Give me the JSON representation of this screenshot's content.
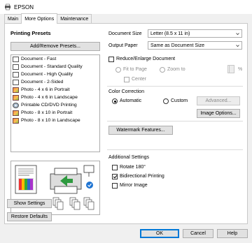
{
  "window": {
    "title": "EPSON"
  },
  "tabs": [
    {
      "label": "Main"
    },
    {
      "label": "More Options"
    },
    {
      "label": "Maintenance"
    }
  ],
  "presets": {
    "heading": "Printing Presets",
    "add_remove_button": "Add/Remove Presets...",
    "items": [
      {
        "label": "Document - Fast",
        "icon": "document"
      },
      {
        "label": "Document - Standard Quality",
        "icon": "document"
      },
      {
        "label": "Document - High Quality",
        "icon": "document"
      },
      {
        "label": "Document - 2-Sided",
        "icon": "document"
      },
      {
        "label": "Photo - 4 x 6 in Portrait",
        "icon": "photo"
      },
      {
        "label": "Photo - 4 x 6 in Landscape",
        "icon": "photo"
      },
      {
        "label": "Printable CD/DVD Printing",
        "icon": "cd"
      },
      {
        "label": "Photo - 8 x 10 in Portrait",
        "icon": "photo"
      },
      {
        "label": "Photo - 8 x 10 in Landscape",
        "icon": "photo"
      }
    ]
  },
  "left_buttons": {
    "show_settings": "Show Settings",
    "restore_defaults": "Restore Defaults"
  },
  "document_size": {
    "label": "Document Size",
    "value": "Letter (8.5 x 11 in)"
  },
  "output_paper": {
    "label": "Output Paper",
    "value": "Same as Document Size"
  },
  "reduce_enlarge": {
    "label": "Reduce/Enlarge Document",
    "checked": false,
    "fit_to_page": "Fit to Page",
    "zoom_to": "Zoom to",
    "center": "Center",
    "percent": "%"
  },
  "color_correction": {
    "heading": "Color Correction",
    "automatic": "Automatic",
    "custom": "Custom",
    "selected": "Automatic",
    "advanced_button": "Advanced...",
    "image_options_button": "Image Options..."
  },
  "watermark_button": "Watermark Features...",
  "additional_settings": {
    "heading": "Additional Settings",
    "rotate": {
      "label": "Rotate 180°",
      "checked": false
    },
    "bidirectional": {
      "label": "Bidirectional Printing",
      "checked": true
    },
    "mirror": {
      "label": "Mirror Image",
      "checked": false
    }
  },
  "footer": {
    "ok": "OK",
    "cancel": "Cancel",
    "help": "Help"
  },
  "colors": {
    "accent": "#0078d7",
    "printer_green": "#2e9a3f",
    "check_blue": "#1e74d2"
  }
}
